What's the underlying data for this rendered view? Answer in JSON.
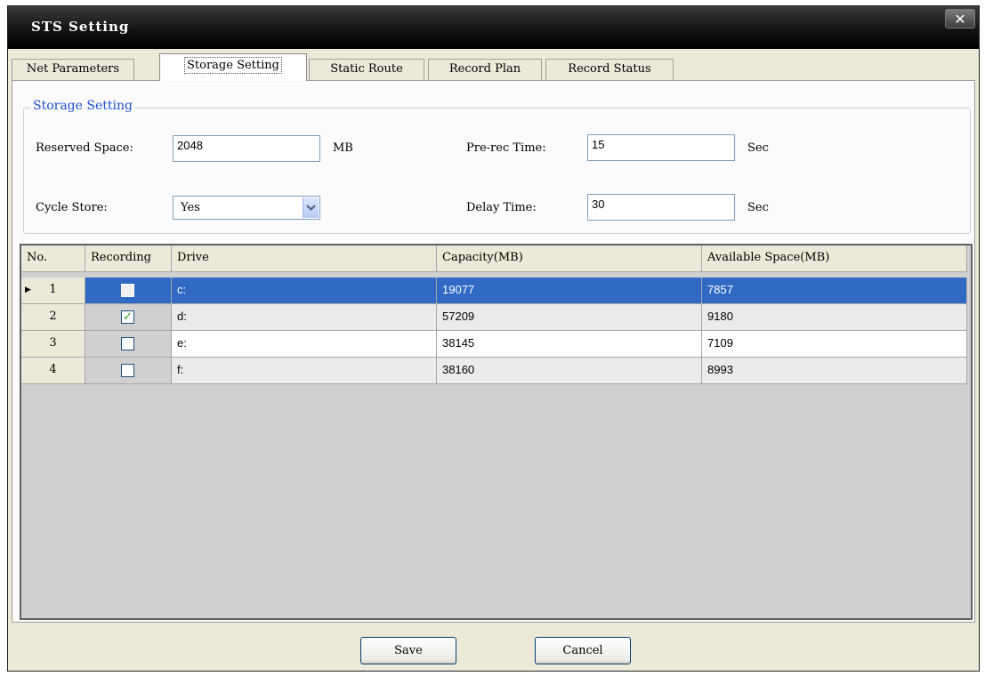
{
  "window": {
    "title": "STS Setting",
    "close_glyph": "✕"
  },
  "tabs": [
    {
      "label": "Net Parameters"
    },
    {
      "label": "Storage Setting"
    },
    {
      "label": "Static Route"
    },
    {
      "label": "Record Plan"
    },
    {
      "label": "Record Status"
    }
  ],
  "storage": {
    "legend": "Storage Setting",
    "reserved_space_label": "Reserved Space:",
    "reserved_space_value": "2048",
    "reserved_space_unit": "MB",
    "prerec_label": "Pre-rec Time:",
    "prerec_value": "15",
    "prerec_unit": "Sec",
    "cycle_label": "Cycle Store:",
    "cycle_value": "Yes",
    "delay_label": "Delay Time:",
    "delay_value": "30",
    "delay_unit": "Sec"
  },
  "table": {
    "headers": [
      "No.",
      "Recording",
      "Drive",
      "Capacity(MB)",
      "Available Space(MB)"
    ],
    "rows": [
      {
        "no": "1",
        "recording": false,
        "drive": "c:",
        "capacity": "19077",
        "available": "7857",
        "selected": true
      },
      {
        "no": "2",
        "recording": true,
        "drive": "d:",
        "capacity": "57209",
        "available": "9180",
        "selected": false
      },
      {
        "no": "3",
        "recording": false,
        "drive": "e:",
        "capacity": "38145",
        "available": "7109",
        "selected": false
      },
      {
        "no": "4",
        "recording": false,
        "drive": "f:",
        "capacity": "38160",
        "available": "8993",
        "selected": false
      }
    ],
    "checked_glyph": "✓"
  },
  "buttons": {
    "save": "Save",
    "cancel": "Cancel"
  }
}
